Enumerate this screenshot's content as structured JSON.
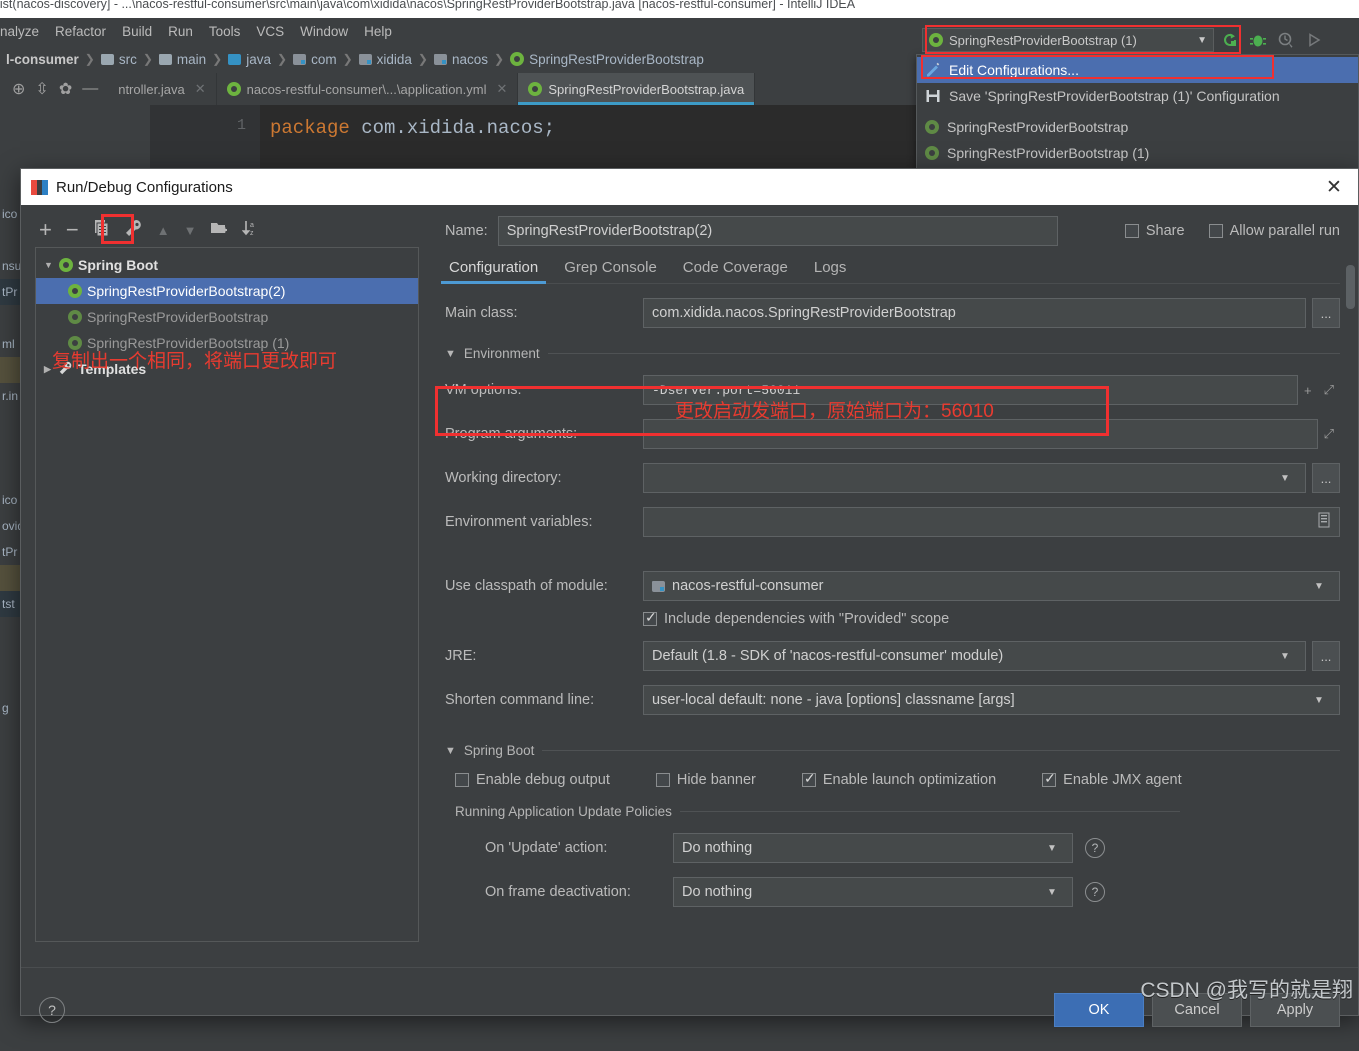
{
  "ide": {
    "window_title": "oList(nacos-discovery] - ...\\nacos-restful-consumer\\src\\main\\java\\com\\xidida\\nacos\\SpringRestProviderBootstrap.java [nacos-restful-consumer] - IntelliJ IDEA",
    "menus": [
      "nalyze",
      "Refactor",
      "Build",
      "Run",
      "Tools",
      "VCS",
      "Window",
      "Help"
    ],
    "breadcrumb": [
      "l-consumer",
      "src",
      "main",
      "java",
      "com",
      "xidida",
      "nacos",
      "SpringRestProviderBootstrap"
    ],
    "tabs": [
      {
        "label": "ntroller.java",
        "active": false
      },
      {
        "label": "nacos-restful-consumer\\...\\application.yml",
        "active": false
      },
      {
        "label": "SpringRestProviderBootstrap.java",
        "active": true
      }
    ],
    "code_line_number": "1",
    "code_keyword": "package",
    "code_rest": " com.xidida.nacos;",
    "behind_strip": [
      "",
      "ico",
      "",
      "nsu",
      "tPr",
      "",
      "ml",
      "",
      "r.in",
      "",
      "",
      "",
      "ico",
      "ovid",
      "tPr",
      "",
      "tst",
      "",
      "",
      "",
      "g"
    ]
  },
  "run_widget": {
    "selected_configuration": "SpringRestProviderBootstrap (1)",
    "run_icon": "rerun-icon",
    "debug_icon": "debug-icon",
    "coverage_icon": "run-with-coverage-icon",
    "play_icon": "play-icon"
  },
  "run_menu": {
    "items": [
      {
        "label": "Edit Configurations...",
        "icon": "pencil-icon",
        "selected": true
      },
      {
        "label": "Save 'SpringRestProviderBootstrap (1)' Configuration",
        "icon": "save-icon",
        "selected": false
      },
      {
        "label": "SpringRestProviderBootstrap",
        "icon": "spring-boot-icon",
        "selected": false
      },
      {
        "label": "SpringRestProviderBootstrap (1)",
        "icon": "spring-boot-icon",
        "selected": false
      }
    ]
  },
  "dialog": {
    "title": "Run/Debug Configurations",
    "close_label": "✕",
    "toolbar": [
      {
        "name": "add-configuration-button",
        "glyph": "+"
      },
      {
        "name": "remove-configuration-button",
        "glyph": "−"
      },
      {
        "name": "copy-configuration-button",
        "glyph": "copy"
      },
      {
        "name": "edit-templates-button",
        "glyph": "wrench"
      },
      {
        "name": "move-up-button",
        "glyph": "▲"
      },
      {
        "name": "move-down-button",
        "glyph": "▼"
      },
      {
        "name": "move-into-folder-button",
        "glyph": "folder-plus"
      },
      {
        "name": "sort-configurations-button",
        "glyph": "sort-az"
      }
    ],
    "tree": [
      {
        "label": "Spring Boot",
        "level": 0,
        "expanded": true,
        "selected": false,
        "icon": "spring-boot-icon"
      },
      {
        "label": "SpringRestProviderBootstrap(2)",
        "level": 1,
        "selected": true,
        "icon": "spring-boot-icon"
      },
      {
        "label": "SpringRestProviderBootstrap",
        "level": 1,
        "selected": false,
        "icon": "spring-boot-icon"
      },
      {
        "label": "SpringRestProviderBootstrap (1)",
        "level": 1,
        "selected": false,
        "icon": "spring-boot-icon"
      },
      {
        "label": "Templates",
        "level": 0,
        "expanded": false,
        "selected": false,
        "icon": "wrench-icon"
      }
    ],
    "annotation_left": "复制出一个相同，将端口更改即可",
    "annotation_vm": "更改启动发端口，原始端口为：56010",
    "name_label": "Name:",
    "name_value": "SpringRestProviderBootstrap(2)",
    "share_label": "Share",
    "share_checked": false,
    "allow_parallel_label": "Allow parallel run",
    "allow_parallel_checked": false,
    "tabs": [
      {
        "label": "Configuration",
        "active": true
      },
      {
        "label": "Grep Console",
        "active": false
      },
      {
        "label": "Code Coverage",
        "active": false
      },
      {
        "label": "Logs",
        "active": false
      }
    ],
    "fields": {
      "main_class_label": "Main class:",
      "main_class_value": "com.xidida.nacos.SpringRestProviderBootstrap",
      "environment_section": "Environment",
      "vm_options_label": "VM options:",
      "vm_options_value": "-Dserver.port=56011",
      "program_arguments_label": "Program arguments:",
      "program_arguments_value": "",
      "working_directory_label": "Working directory:",
      "working_directory_value": "",
      "environment_variables_label": "Environment variables:",
      "environment_variables_value": "",
      "use_classpath_label": "Use classpath of module:",
      "use_classpath_value": "nacos-restful-consumer",
      "include_provided_label": "Include dependencies with \"Provided\" scope",
      "include_provided_checked": true,
      "jre_label": "JRE:",
      "jre_value": "Default (1.8 - SDK of 'nacos-restful-consumer' module)",
      "shorten_label": "Shorten command line:",
      "shorten_value": "user-local default: none - java [options] classname [args]"
    },
    "spring_boot_section": {
      "title": "Spring Boot",
      "checkboxes": [
        {
          "label": "Enable debug output",
          "checked": false
        },
        {
          "label": "Hide banner",
          "checked": false
        },
        {
          "label": "Enable launch optimization",
          "checked": true
        },
        {
          "label": "Enable JMX agent",
          "checked": true
        }
      ],
      "policies_title": "Running Application Update Policies",
      "on_update_label": "On 'Update' action:",
      "on_update_value": "Do nothing",
      "on_frame_label": "On frame deactivation:",
      "on_frame_value": "Do nothing",
      "help_glyph": "?"
    },
    "footer": {
      "help_glyph": "?",
      "ok_label": "OK",
      "cancel_label": "Cancel",
      "apply_label": "Apply"
    }
  },
  "watermark": "CSDN @我写的就是翔",
  "colors": {
    "accent_blue": "#4b6eaf",
    "annotation_red": "#e83b30",
    "highlight_red": "#f03030",
    "tab_underline": "#4d9ad4",
    "spring_green": "#6db33f"
  }
}
